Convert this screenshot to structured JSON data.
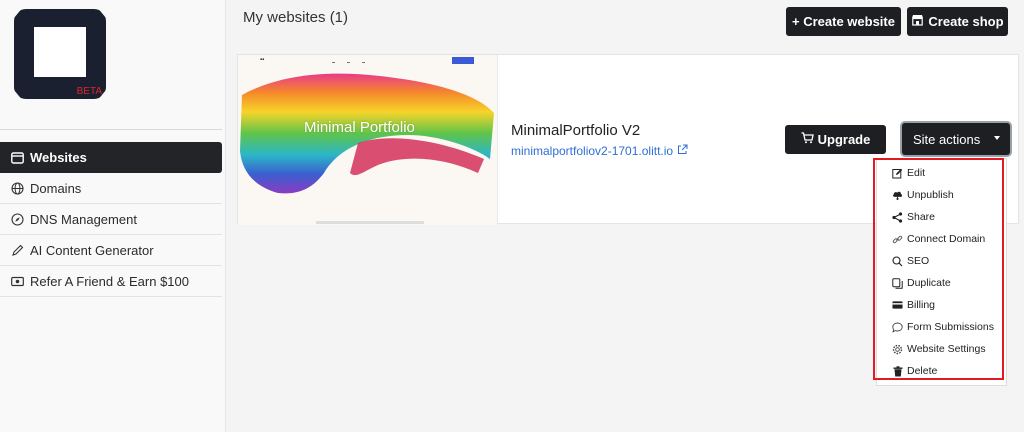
{
  "sidebar": {
    "logo_badge": "BETA",
    "items": [
      {
        "label": "Websites",
        "icon": "browser-window-icon",
        "active": true
      },
      {
        "label": "Domains",
        "icon": "globe-icon",
        "active": false
      },
      {
        "label": "DNS Management",
        "icon": "compass-icon",
        "active": false
      },
      {
        "label": "AI Content Generator",
        "icon": "pencil-icon",
        "active": false
      },
      {
        "label": "Refer A Friend & Earn $100",
        "icon": "cash-icon",
        "active": false
      }
    ]
  },
  "header": {
    "title": "My websites (1)",
    "create_website_label": "+ Create website",
    "create_shop_label": "Create shop"
  },
  "website": {
    "name": "MinimalPortfolio V2",
    "url": "minimalportfoliov2-1701.olitt.io",
    "thumbnail_title": "Minimal Portfolio",
    "upgrade_label": "Upgrade",
    "actions_label": "Site actions"
  },
  "site_actions_menu": [
    {
      "label": "Edit",
      "icon": "edit-icon"
    },
    {
      "label": "Unpublish",
      "icon": "cloud-icon"
    },
    {
      "label": "Share",
      "icon": "share-icon"
    },
    {
      "label": "Connect Domain",
      "icon": "link-icon"
    },
    {
      "label": "SEO",
      "icon": "search-icon"
    },
    {
      "label": "Duplicate",
      "icon": "duplicate-icon"
    },
    {
      "label": "Billing",
      "icon": "credit-card-icon"
    },
    {
      "label": "Form Submissions",
      "icon": "chat-icon"
    },
    {
      "label": "Website Settings",
      "icon": "gear-icon"
    },
    {
      "label": "Delete",
      "icon": "trash-icon"
    }
  ],
  "colors": {
    "dark_button": "#1d1f22",
    "link": "#2d6fd6",
    "highlight": "#e01b24"
  }
}
